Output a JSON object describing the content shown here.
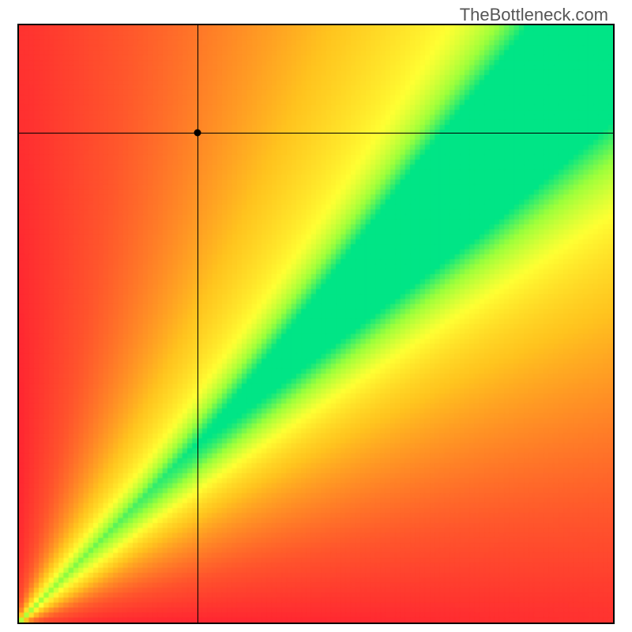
{
  "watermark": "TheBottleneck.com",
  "chart_data": {
    "type": "heatmap",
    "title": "",
    "xlabel": "",
    "ylabel": "",
    "xlim": [
      0,
      100
    ],
    "ylim": [
      0,
      100
    ],
    "crosshair": {
      "x": 30,
      "y": 82
    },
    "marker": {
      "x": 30,
      "y": 82
    },
    "colormap": [
      "#ff1a33",
      "#ff6e2a",
      "#ffc41f",
      "#ffff33",
      "#9cff3c",
      "#00e586"
    ],
    "optimal_band": {
      "description": "Green diagonal band where GPU/CPU ratio ≈ 1",
      "lower_slope": 0.8,
      "upper_slope": 1.2
    },
    "grid": false,
    "legend": false,
    "resolution": 120
  }
}
